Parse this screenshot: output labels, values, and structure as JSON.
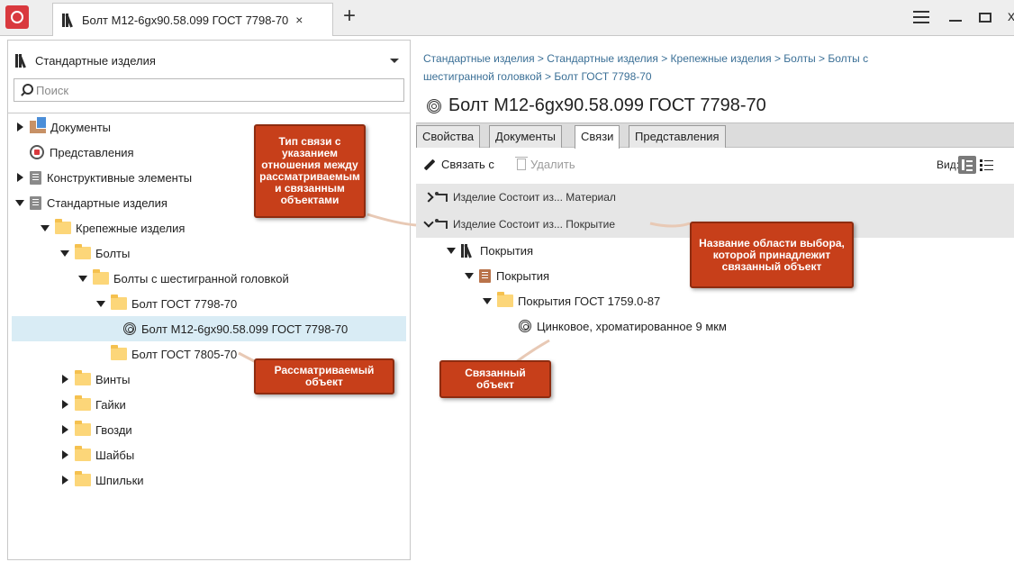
{
  "titlebar": {
    "tab_title": "Болт М12-6gx90.58.099 ГОСТ 7798-70",
    "close_glyph": "×",
    "add_glyph": "+",
    "window_close_glyph": "x"
  },
  "library": {
    "name": "Стандартные изделия",
    "search_placeholder": "Поиск"
  },
  "left_tree": [
    {
      "label": "Документы"
    },
    {
      "label": "Представления"
    },
    {
      "label": "Конструктивные элементы"
    },
    {
      "label": "Стандартные изделия"
    },
    {
      "label": "Крепежные изделия"
    },
    {
      "label": "Болты"
    },
    {
      "label": "Болты с шестигранной головкой"
    },
    {
      "label": "Болт ГОСТ 7798-70"
    },
    {
      "label": "Болт М12-6gx90.58.099 ГОСТ 7798-70"
    },
    {
      "label": "Болт ГОСТ 7805-70"
    },
    {
      "label": "Винты"
    },
    {
      "label": "Гайки"
    },
    {
      "label": "Гвозди"
    },
    {
      "label": "Шайбы"
    },
    {
      "label": "Шпильки"
    }
  ],
  "breadcrumb": {
    "line1": "Стандартные изделия > Стандартные изделия > Крепежные изделия > Болты > Болты с",
    "line2": "шестигранной головкой > Болт ГОСТ 7798-70"
  },
  "page_title": "Болт М12-6gx90.58.099 ГОСТ 7798-70",
  "tabs": [
    {
      "label": "Свойства"
    },
    {
      "label": "Документы"
    },
    {
      "label": "Связи"
    },
    {
      "label": "Представления"
    }
  ],
  "toolbar": {
    "link_label": "Связать с",
    "delete_label": "Удалить",
    "view_label": "Вид:"
  },
  "relations": [
    {
      "label": "Изделие Состоит из... Материал"
    },
    {
      "label": "Изделие Состоит из... Покрытие"
    }
  ],
  "right_tree": [
    {
      "label": "Покрытия"
    },
    {
      "label": "Покрытия"
    },
    {
      "label": "Покрытия ГОСТ 1759.0-87"
    },
    {
      "label": "Цинковое, хроматированное 9 мкм"
    }
  ],
  "callouts": {
    "relation_type": "Тип связи с указанием отношения между рассматриваемым и связанным объектами",
    "selection_area": "Название области выбора, которой принадлежит связанный объект",
    "considered_object": "Рассматриваемый объект",
    "linked_object": "Связанный объект"
  },
  "colors": {
    "accent_callout": "#c73f1a",
    "selection": "#d9ecf5",
    "link_text": "#3a6f96",
    "folder": "#fcd679"
  }
}
